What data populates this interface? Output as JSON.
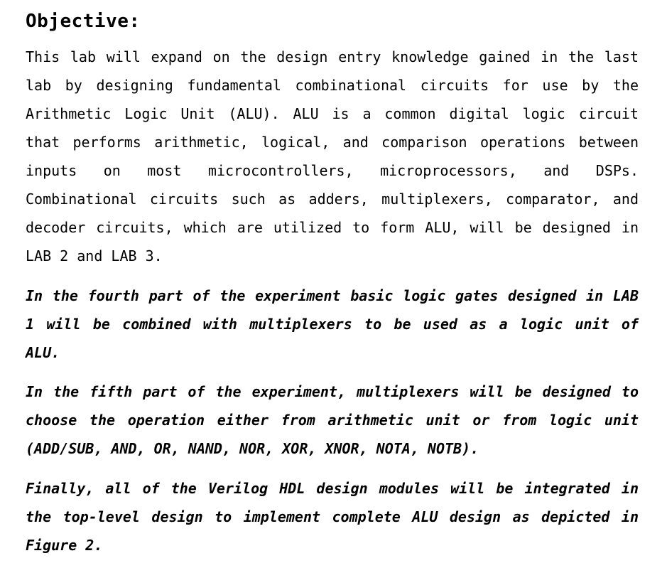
{
  "document": {
    "heading": "Objective:",
    "paragraphs": [
      {
        "style": "normal",
        "lines": [
          "This lab will expand on the design entry knowledge gained in the last",
          "lab by designing fundamental combinational circuits for use by the",
          "Arithmetic Logic Unit (ALU). ALU is a common digital logic circuit",
          "that performs arithmetic, logical, and comparison operations between",
          "inputs on most microcontrollers, microprocessors, and DSPs.",
          "Combinational circuits such as adders, multiplexers, comparator, and",
          "decoder circuits, which are utilized to form ALU, will be designed in",
          "LAB 2 and LAB 3."
        ]
      },
      {
        "style": "italic",
        "lines": [
          "In the fourth part of the experiment basic logic gates designed in LAB",
          "1 will be combined with multiplexers to be used as a logic unit of",
          "ALU."
        ]
      },
      {
        "style": "italic",
        "lines": [
          "In the fifth part of the experiment, multiplexers will be designed to",
          "choose the operation either from arithmetic unit or from logic unit",
          "(ADD/SUB, AND, OR, NAND, NOR, XOR, XNOR, NOTA, NOTB)."
        ]
      },
      {
        "style": "italic",
        "lines": [
          "Finally, all of the Verilog HDL design modules will be integrated in",
          "the top-level design to implement complete ALU design as depicted in",
          "Figure 2."
        ]
      }
    ]
  }
}
